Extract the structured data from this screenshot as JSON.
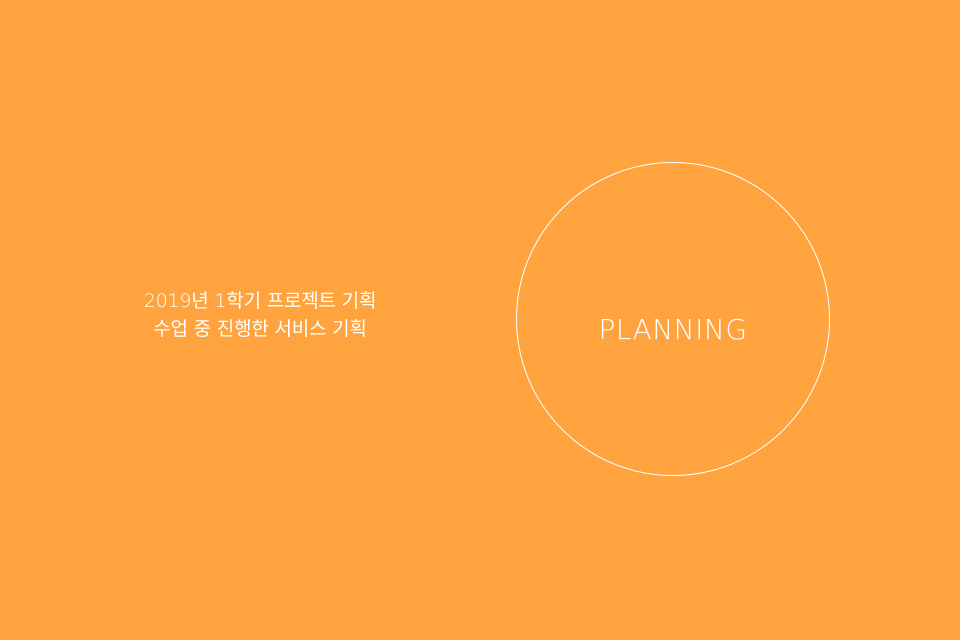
{
  "colors": {
    "background": "#FFA33F",
    "foreground": "#FFFFFF"
  },
  "description": {
    "line1": "2019년 1학기 프로젝트 기획",
    "line2": "수업 중 진행한 서비스 기획"
  },
  "badge": {
    "label": "PLANNING"
  }
}
